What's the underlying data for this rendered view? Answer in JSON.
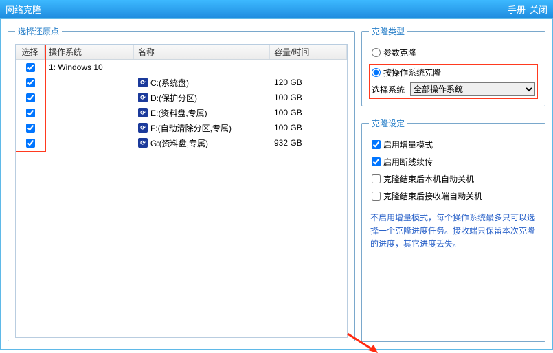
{
  "titlebar": {
    "title": "网络克隆",
    "manual": "手册",
    "close": "关闭"
  },
  "left": {
    "legend": "选择还原点",
    "headers": {
      "select": "选择",
      "os": "操作系统",
      "name": "名称",
      "capacity": "容量/时间"
    },
    "rows": [
      {
        "checked": true,
        "os": "1: Windows 10",
        "name": "",
        "cap": "",
        "icon": false
      },
      {
        "checked": true,
        "os": "",
        "name": "C:(系统盘)",
        "cap": "120 GB",
        "icon": true
      },
      {
        "checked": true,
        "os": "",
        "name": "D:(保护分区)",
        "cap": "100 GB",
        "icon": true
      },
      {
        "checked": true,
        "os": "",
        "name": "E:(资料盘,专属)",
        "cap": "100 GB",
        "icon": true
      },
      {
        "checked": true,
        "os": "",
        "name": "F:(自动清除分区,专属)",
        "cap": "100 GB",
        "icon": true
      },
      {
        "checked": true,
        "os": "",
        "name": "G:(资料盘,专属)",
        "cap": "932 GB",
        "icon": true
      }
    ]
  },
  "cloneType": {
    "legend": "克隆类型",
    "paramClone": "参数克隆",
    "byOsClone": "按操作系统克隆",
    "selected": "byOs",
    "selectSysLabel": "选择系统",
    "selectSysValue": "全部操作系统"
  },
  "cloneSettings": {
    "legend": "克隆设定",
    "incr": {
      "label": "启用增量模式",
      "checked": true
    },
    "resume": {
      "label": "启用断线续传",
      "checked": true
    },
    "shutdownLocal": {
      "label": "克隆结束后本机自动关机",
      "checked": false
    },
    "shutdownRecv": {
      "label": "克隆结束后接收端自动关机",
      "checked": false
    },
    "note": "不启用增量模式，每个操作系统最多只可以选择一个克隆进度任务。接收端只保留本次克隆的进度，其它进度丢失。"
  }
}
